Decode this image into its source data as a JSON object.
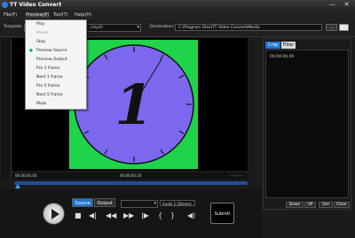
{
  "window": {
    "title": "TT Video Convert",
    "minimize": "—",
    "close": "✕"
  },
  "menubar": {
    "items": [
      "File(F)",
      "Preview(P)",
      "Tool(T)",
      "Help(H)"
    ]
  },
  "toolbar": {
    "template_label": "Template",
    "template_value": "...(mp4)",
    "destination_label": "Destination:",
    "destination_value": "C:\\Program Files\\TT Video Convert\\Media",
    "browse_label": "..."
  },
  "preview_menu": {
    "items": [
      {
        "label": "Play",
        "enabled": true,
        "checked": false
      },
      {
        "label": "Pause",
        "enabled": false,
        "checked": false
      },
      {
        "label": "Stop",
        "enabled": true,
        "checked": false
      },
      {
        "label": "Preview Source",
        "enabled": true,
        "checked": true
      },
      {
        "label": "Preview Output",
        "enabled": true,
        "checked": false
      },
      {
        "label": "Pre 1 frame",
        "enabled": true,
        "checked": false
      },
      {
        "label": "Next 1 frame",
        "enabled": true,
        "checked": false
      },
      {
        "label": "Pre 5 frame",
        "enabled": true,
        "checked": false
      },
      {
        "label": "Next 5 frame",
        "enabled": true,
        "checked": false
      },
      {
        "label": "Mute",
        "enabled": true,
        "checked": false
      }
    ]
  },
  "video": {
    "frame_digit": "1",
    "colors": {
      "background": "#1fd44a",
      "clock_face": "#7b68ee"
    }
  },
  "timeline": {
    "start_time": "00:00:00.00",
    "end_time": "00:00:00.00",
    "right_marker": "- - -:- - -",
    "position": 0
  },
  "panel": {
    "tabs": [
      "Crop",
      "Filter"
    ],
    "active_tab": "Crop",
    "time": "00:00:00.00",
    "buttons": [
      "Down",
      "UP",
      "Del",
      "Clear"
    ]
  },
  "controls": {
    "source_label": "Source",
    "output_label": "Output",
    "audio_label": "Audio 1 [Stereo]",
    "submit_label": "Submit",
    "icons": [
      "stop-icon",
      "previous-frame-icon",
      "rewind-icon",
      "fast-forward-icon",
      "next-frame-icon",
      "mark-in-icon",
      "mark-out-icon",
      "volume-icon"
    ]
  }
}
